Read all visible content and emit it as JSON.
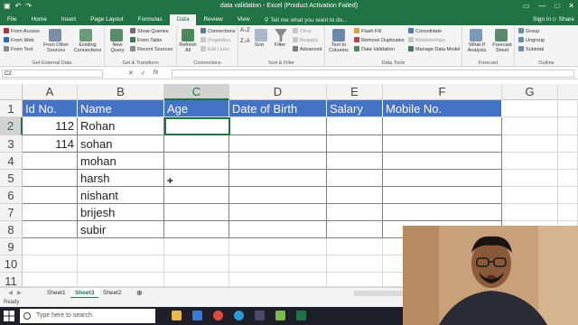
{
  "window": {
    "title": "data validation - Excel (Product Activation Failed)",
    "signin": "Sign in",
    "share": "Share"
  },
  "tabs": [
    "File",
    "Home",
    "Insert",
    "Page Layout",
    "Formulas",
    "Data",
    "Review",
    "View"
  ],
  "active_tab": "Data",
  "tell_me": "Tell me what you want to do...",
  "ribbon": {
    "get_external": {
      "items": [
        "From Access",
        "From Web",
        "From Text",
        "From Other Sources",
        "Existing Connections"
      ],
      "label": "Get External Data"
    },
    "get_transform": {
      "new_query": "New Query",
      "items": [
        "Show Queries",
        "From Table",
        "Recent Sources"
      ],
      "label": "Get & Transform"
    },
    "connections": {
      "refresh": "Refresh All",
      "items": [
        "Connections",
        "Properties",
        "Edit Links"
      ],
      "label": "Connections"
    },
    "sort_filter": {
      "sort": "Sort",
      "filter": "Filter",
      "items": [
        "Clear",
        "Reapply",
        "Advanced"
      ],
      "label": "Sort & Filter"
    },
    "data_tools": {
      "text_to_columns": "Text to Columns",
      "items": [
        "Flash Fill",
        "Remove Duplicates",
        "Data Validation",
        "Consolidate",
        "Relationships",
        "Manage Data Model"
      ],
      "label": "Data Tools"
    },
    "forecast": {
      "items": [
        "What-If Analysis",
        "Forecast Sheet"
      ],
      "label": "Forecast"
    },
    "outline": {
      "items": [
        "Group",
        "Ungroup",
        "Subtotal"
      ],
      "label": "Outline"
    }
  },
  "formula_bar": {
    "name_box": "C2",
    "fx": "fx",
    "value": ""
  },
  "grid": {
    "columns": [
      "A",
      "B",
      "C",
      "D",
      "E",
      "F",
      "G"
    ],
    "selected_column": "C",
    "rows": [
      "1",
      "2",
      "3",
      "4",
      "5",
      "6",
      "7",
      "8",
      "9",
      "10",
      "11"
    ],
    "selected_row": "2",
    "headers": [
      "Id No.",
      "Name",
      "Age",
      "Date of Birth",
      "Salary",
      "Mobile No."
    ],
    "data": [
      [
        "112",
        "Rohan",
        "",
        "",
        "",
        ""
      ],
      [
        "114",
        "sohan",
        "",
        "",
        "",
        ""
      ],
      [
        "",
        "mohan",
        "",
        "",
        "",
        ""
      ],
      [
        "",
        "harsh",
        "",
        "",
        "",
        ""
      ],
      [
        "",
        "nishant",
        "",
        "",
        "",
        ""
      ],
      [
        "",
        "brijesh",
        "",
        "",
        "",
        ""
      ],
      [
        "",
        "subir",
        "",
        "",
        "",
        ""
      ]
    ]
  },
  "sheets": [
    "Sheet1",
    "Sheet3",
    "Sheet2"
  ],
  "active_sheet": "Sheet3",
  "status": "Ready",
  "taskbar": {
    "search_placeholder": "Type here to search"
  },
  "colors": {
    "excel_green": "#217346",
    "header_fill": "#4472c4"
  }
}
